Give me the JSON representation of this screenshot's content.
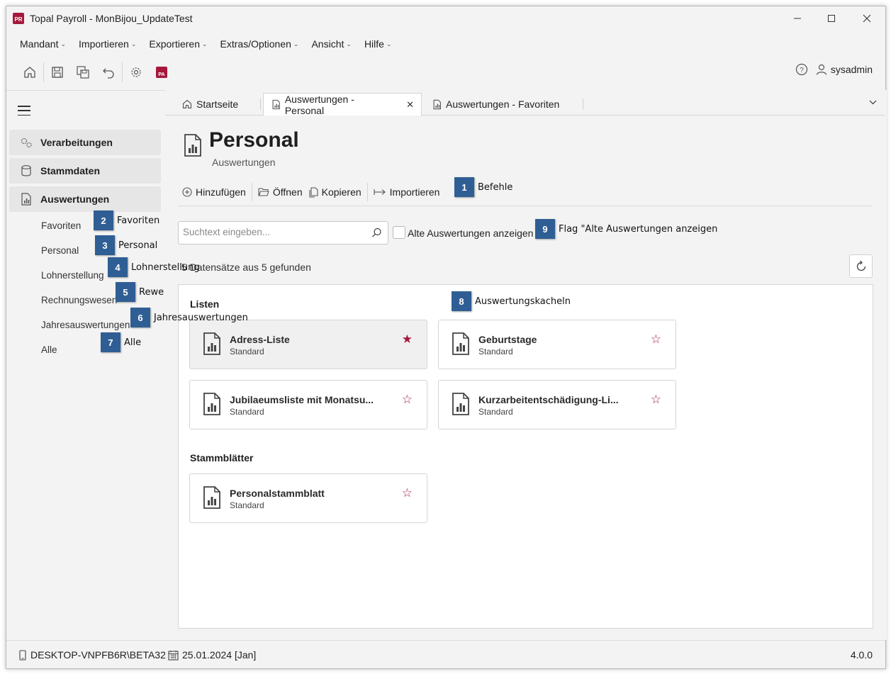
{
  "window": {
    "title": "Topal Payroll - MonBijou_UpdateTest",
    "logo_text": "PR"
  },
  "menu": [
    {
      "label": "Mandant"
    },
    {
      "label": "Importieren"
    },
    {
      "label": "Exportieren"
    },
    {
      "label": "Extras/Optionen"
    },
    {
      "label": "Ansicht"
    },
    {
      "label": "Hilfe"
    }
  ],
  "toolbar": {
    "pa_label": "PA",
    "user": "sysadmin"
  },
  "sidebar": {
    "groups": [
      {
        "label": "Verarbeitungen",
        "icon": "gears-icon"
      },
      {
        "label": "Stammdaten",
        "icon": "database-icon"
      },
      {
        "label": "Auswertungen",
        "icon": "report-icon"
      }
    ],
    "subitems": [
      {
        "label": "Favoriten"
      },
      {
        "label": "Personal"
      },
      {
        "label": "Lohnerstellung"
      },
      {
        "label": "Rechnungswesen"
      },
      {
        "label": "Jahresauswertungen"
      },
      {
        "label": "Alle"
      }
    ]
  },
  "tabs": [
    {
      "label": "Startseite"
    },
    {
      "label": "Auswertungen - Personal"
    },
    {
      "label": "Auswertungen - Favoriten"
    }
  ],
  "page": {
    "title": "Personal",
    "subtitle": "Auswertungen"
  },
  "commands": [
    {
      "label": "Hinzufügen"
    },
    {
      "label": "Öffnen"
    },
    {
      "label": "Kopieren"
    },
    {
      "label": "Importieren"
    }
  ],
  "search": {
    "placeholder": "Suchtext eingeben...",
    "value": ""
  },
  "filter": {
    "label": "Alte Auswertungen anzeigen",
    "checked": false
  },
  "result_count": "5 Datensätze aus 5 gefunden",
  "sections": [
    {
      "title": "Listen",
      "tiles": [
        {
          "name": "Adress-Liste",
          "sub": "Standard",
          "favorite": true
        },
        {
          "name": "Geburtstage",
          "sub": "Standard",
          "favorite": false
        },
        {
          "name": "Jubilaeumsliste mit Monatsu...",
          "sub": "Standard",
          "favorite": false
        },
        {
          "name": "Kurzarbeitentschädigung-Li...",
          "sub": "Standard",
          "favorite": false
        }
      ]
    },
    {
      "title": "Stammblätter",
      "tiles": [
        {
          "name": "Personalstammblatt",
          "sub": "Standard",
          "favorite": false
        }
      ]
    }
  ],
  "annotations": [
    {
      "number": "1",
      "label": "Befehle"
    },
    {
      "number": "2",
      "label": "Favoriten"
    },
    {
      "number": "3",
      "label": "Personal"
    },
    {
      "number": "4",
      "label": "Lohnerstellung"
    },
    {
      "number": "5",
      "label": "Rewe"
    },
    {
      "number": "6",
      "label": "Jahresauswertungen"
    },
    {
      "number": "7",
      "label": "Alle"
    },
    {
      "number": "8",
      "label": "Auswertungskacheln"
    },
    {
      "number": "9",
      "label": "Flag \"Alte Auswertungen anzeigen"
    }
  ],
  "status": {
    "machine": "DESKTOP-VNPFB6R\\BETA32",
    "date": "25.01.2024 [Jan]",
    "version": "4.0.0"
  },
  "colors": {
    "brand": "#a5183c",
    "badge": "#2f5e94"
  }
}
